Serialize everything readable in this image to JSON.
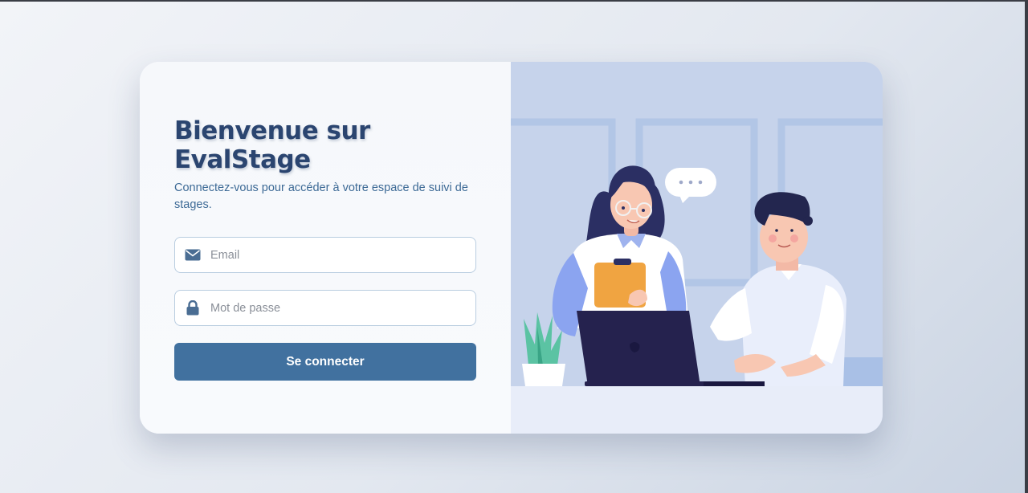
{
  "login": {
    "title": "Bienvenue sur EvalStage",
    "subtitle": "Connectez-vous pour accéder à votre espace de suivi de stages.",
    "email_placeholder": "Email",
    "password_placeholder": "Mot de passe",
    "submit_label": "Se connecter"
  },
  "icons": {
    "email": "envelope-icon",
    "password": "lock-icon"
  },
  "colors": {
    "accent": "#41719f",
    "title": "#2b4570",
    "illustration_bg": "#c6d3eb"
  }
}
